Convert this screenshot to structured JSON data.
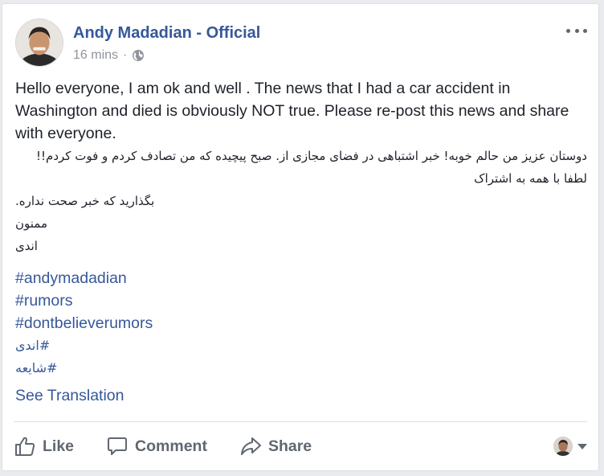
{
  "post": {
    "author": "Andy Madadian - Official",
    "time": "16 mins",
    "separator": "·",
    "privacy_icon": "globe-icon",
    "text_en": "Hello everyone, I am ok and well . The news that I had a car accident in Washington and died is obviously NOT true. Please re-post this news and share with everyone.",
    "text_fa_1": "دوستان عزیز من حالم خوبه! خبر اشتباهی در فضای مجازی از. صبح پیچیده که من تصادف کردم و فوت کردم!! لطفا با همه به اشتراک",
    "text_fa_2": "بگذارید که خبر صحت نداره.",
    "text_fa_3": "ممنون",
    "text_fa_4": "اندی",
    "hashtags": [
      "#andymadadian",
      "#rumors",
      "#dontbelieverumors"
    ],
    "hashtags_fa": [
      "#اندی",
      "#شایعه"
    ],
    "see_translation": "See Translation"
  },
  "actions": {
    "like": "Like",
    "comment": "Comment",
    "share": "Share"
  },
  "colors": {
    "link": "#365899",
    "text": "#1d2129",
    "muted": "#90949c",
    "action": "#606770",
    "background": "#e9ebee"
  }
}
